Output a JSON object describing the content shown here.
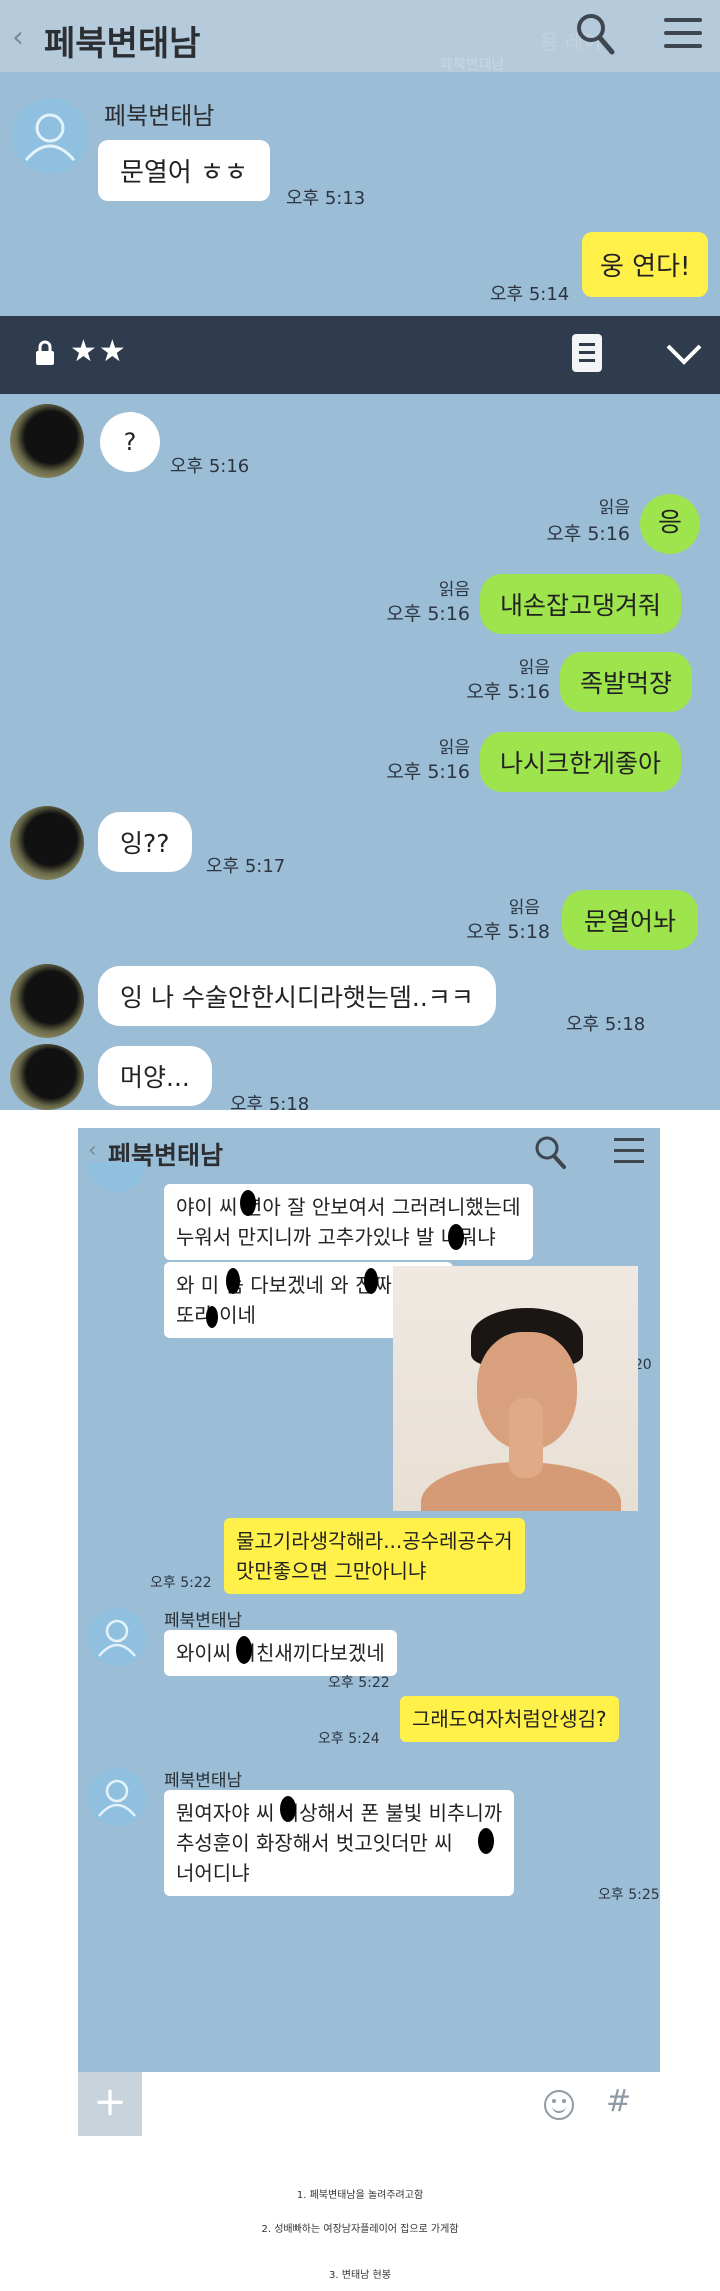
{
  "screenshot1": {
    "title": "페북변태남",
    "back_icon": "chevron-left-icon",
    "search_overlay_text": "용 레이",
    "faded_sender": "페북변태남",
    "sender": "페북변태남",
    "messages": [
      {
        "text": "문열어 ㅎㅎ",
        "time": "오후 5:13"
      },
      {
        "text": "웅 연다!",
        "time": "오후 5:14"
      }
    ],
    "second_bar": {
      "stars": "★★"
    },
    "chat2": [
      {
        "text": "?",
        "time": "오후 5:16"
      },
      {
        "text": "응",
        "read": "읽음",
        "time": "오후 5:16"
      },
      {
        "text": "내손잡고댕겨줘",
        "read": "읽음",
        "time": "오후 5:16"
      },
      {
        "text": "족발먹쟝",
        "read": "읽음",
        "time": "오후 5:16"
      },
      {
        "text": "나시크한게좋아",
        "read": "읽음",
        "time": "오후 5:16"
      },
      {
        "text": "잉??",
        "time": "오후 5:17"
      },
      {
        "text": "문열어놔",
        "read": "읽음",
        "time": "오후 5:18"
      },
      {
        "text": "잉 나 수술안한시디라햇는뎀..ㅋㅋ",
        "time": "오후 5:18"
      },
      {
        "text": "머양...",
        "time": "오후 5:18"
      }
    ]
  },
  "screenshot2": {
    "title": "페북변태남",
    "messages": [
      {
        "line1": "야이 씨  년아 잘 안보여서 그러려니했는데",
        "line2": "누워서 만지니까 고추가있냐   발 너뭐냐"
      },
      {
        "line1": "와 미  놈 다보겠네 와 진짜   발 상",
        "line2": "또라 이네",
        "time": "오후 5:20"
      },
      {
        "line1": "물고기라생각해라...공수레공수거",
        "line2": "맛만좋으면 그만아니냐",
        "time": "오후 5:22"
      },
      {
        "sender": "페북변태남",
        "line1": "와이씨  미친새끼다보겠네",
        "time": "오후 5:22"
      },
      {
        "line1": "그래도여자처럼안생김?",
        "time": "오후 5:24"
      },
      {
        "sender": "페북변태남",
        "line1": "뭔여자야 씨  이상해서 폰 불빛 비추니까",
        "line2": "추성훈이 화장해서 벗고잇더만 씨",
        "line3": "너어디냐",
        "time": "오후 5:25"
      }
    ]
  },
  "captions": [
    "1. 페북변태남을 놀려주려고함",
    "2. 성배빠하는 여장남자플레이어 집으로 가게함",
    "3. 변태남 현봉"
  ]
}
